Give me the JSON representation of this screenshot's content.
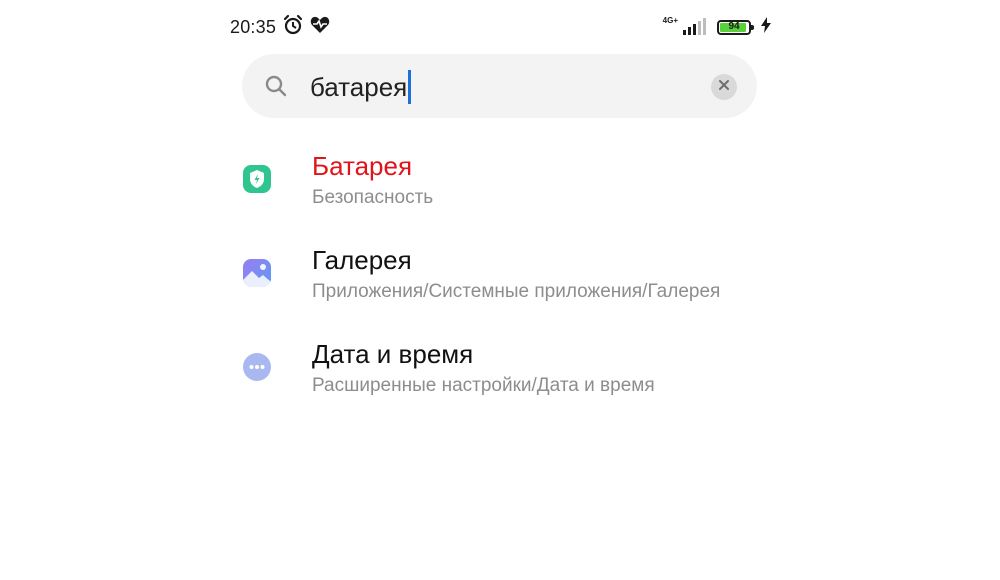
{
  "status_bar": {
    "time": "20:35",
    "network": "4G+",
    "battery_level": "94",
    "icons": [
      "alarm-icon",
      "heart-rate-icon",
      "signal-icon",
      "battery-icon",
      "charging-icon"
    ]
  },
  "search": {
    "query": "батарея",
    "clear_icon": "close-icon"
  },
  "results": [
    {
      "title": "Батарея",
      "subtitle": "Безопасность",
      "icon": "security-shield-icon",
      "highlight": true
    },
    {
      "title": "Галерея",
      "subtitle": "Приложения/Системные приложения/Галерея",
      "icon": "gallery-icon",
      "highlight": false
    },
    {
      "title": "Дата и время",
      "subtitle": "Расширенные настройки/Дата и время",
      "icon": "more-dots-icon",
      "highlight": false
    }
  ],
  "colors": {
    "highlight": "#e0151b",
    "security_green": "#2ec58e",
    "gallery_blue": "#6f8cf5",
    "more_icon": "#a9b8f0",
    "caret": "#1e6fd9",
    "battery_fill": "#5ad13c"
  }
}
